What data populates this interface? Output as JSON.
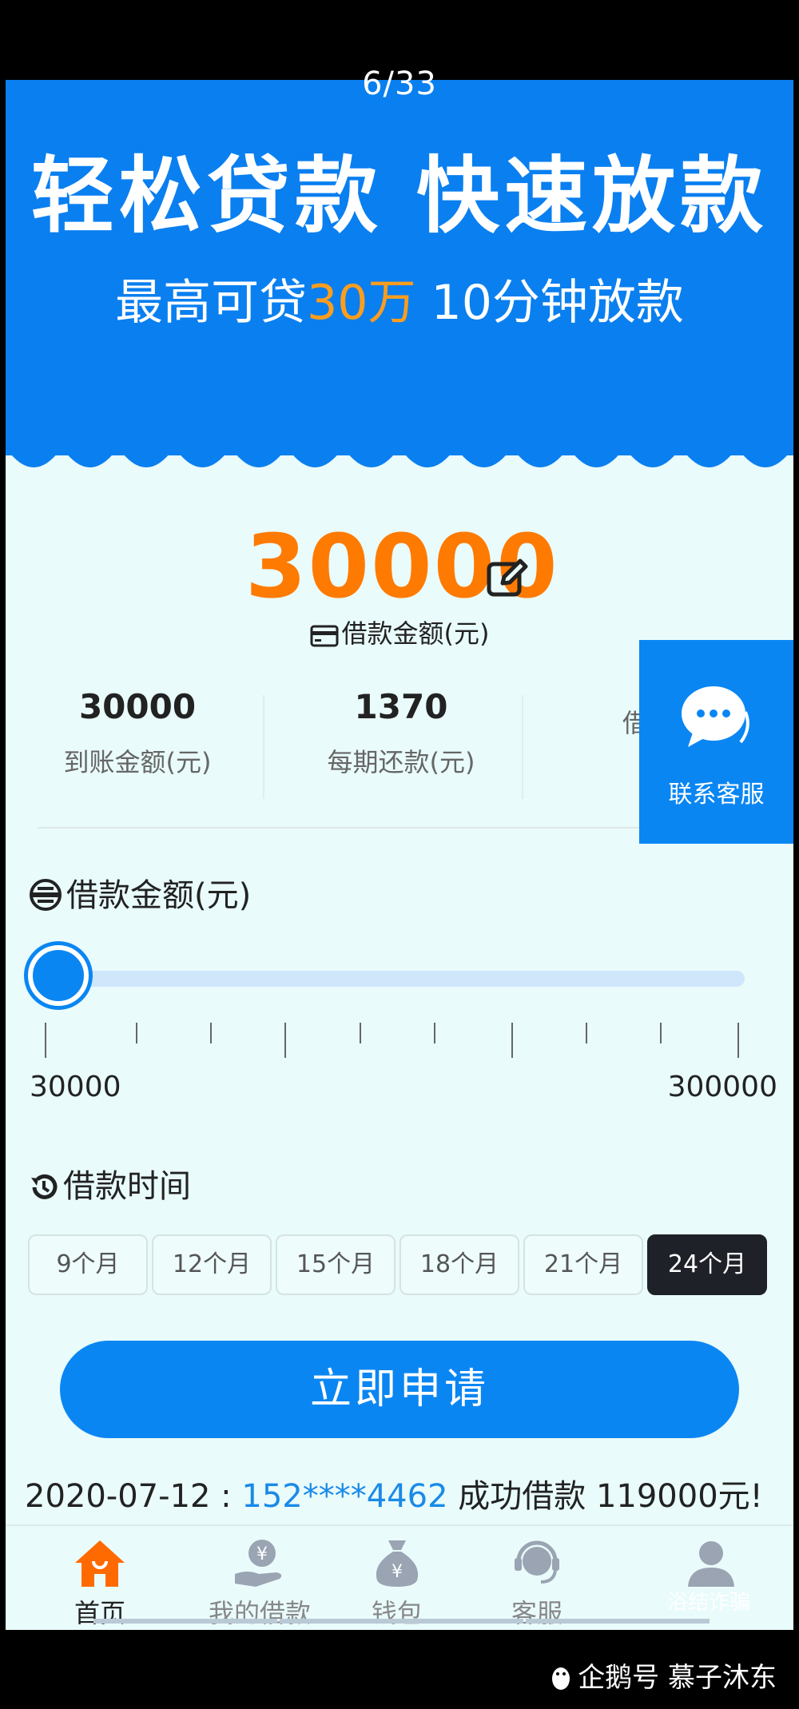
{
  "viewer": {
    "counter": "6/33"
  },
  "banner": {
    "headline": "轻松贷款 快速放款",
    "sub_prefix": "最高可贷",
    "sub_highlight": "30万",
    "sub_suffix": " 10分钟放款"
  },
  "loan": {
    "amount": "30000",
    "amount_caption": "借款金额(元)"
  },
  "stats": [
    {
      "value": "30000",
      "label": "到账金额(元)"
    },
    {
      "value": "1370",
      "label": "每期还款(元)"
    },
    {
      "value": "",
      "label": "借款时"
    }
  ],
  "customer_service_float": {
    "label": "联系客服"
  },
  "amount_section": {
    "title": "借款金额(元)",
    "min_label": "30000",
    "max_label": "300000",
    "slider_value": 30000
  },
  "term_section": {
    "title": "借款时间",
    "options": [
      "9个月",
      "12个月",
      "15个月",
      "18个月",
      "21个月",
      "24个月"
    ],
    "selected": "24个月"
  },
  "apply_button": {
    "label": "立即申请"
  },
  "ticker": {
    "date": "2020-07-12 : ",
    "phone": "152****4462",
    "message": " 成功借款 119000元!"
  },
  "tabbar": [
    {
      "label": "首页",
      "icon": "home-icon",
      "active": true
    },
    {
      "label": "我的借款",
      "icon": "yen-hand-icon",
      "active": false
    },
    {
      "label": "钱包",
      "icon": "money-bag-icon",
      "active": false
    },
    {
      "label": "客服",
      "icon": "headset-icon",
      "active": false
    },
    {
      "label": "",
      "icon": "user-icon",
      "active": false
    }
  ],
  "watermark": {
    "overlay_text": "浴结诈骗",
    "brand": "企鹅号 慕子沐东"
  },
  "colors": {
    "primary": "#0a86f3",
    "banner": "#0a7ff0",
    "accent_orange": "#ff7a00",
    "page_bg": "#e9fbfb",
    "selected_term": "#1f2128"
  }
}
